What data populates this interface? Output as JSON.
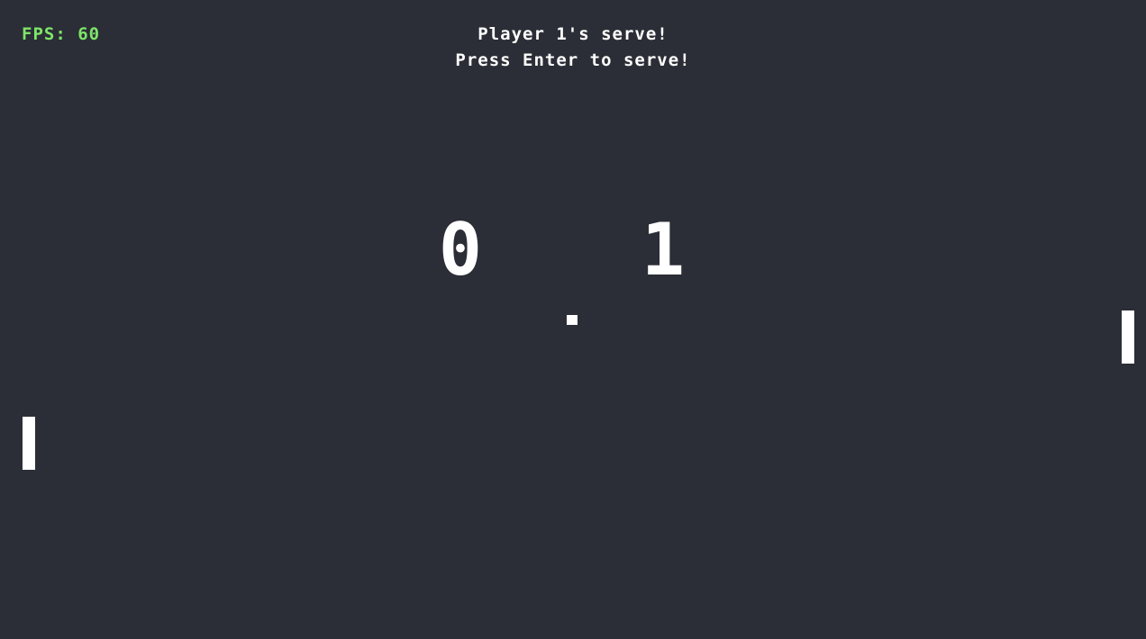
{
  "hud": {
    "fps_text": "FPS: 60"
  },
  "status": {
    "line1": "Player 1's serve!",
    "line2": "Press Enter to serve!"
  },
  "scores": {
    "player1": "0",
    "player2": "1"
  },
  "colors": {
    "background": "#2b2e36",
    "foreground": "#ffffff",
    "fps": "#7ee66a"
  }
}
